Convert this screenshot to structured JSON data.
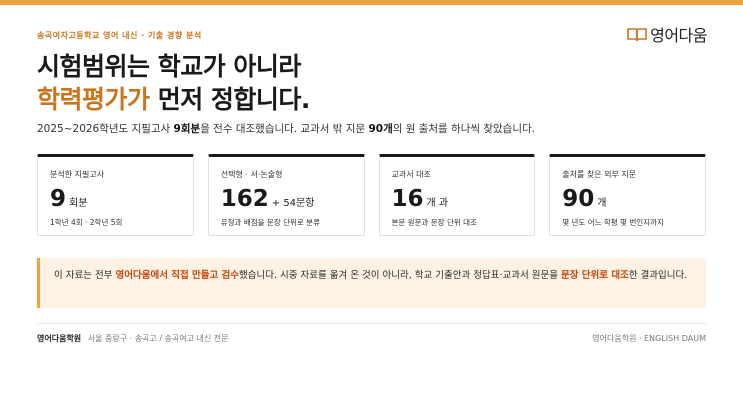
{
  "eyebrow": "송곡여자고등학교 영어 내신 · 기출 경향 분석",
  "logo": {
    "text": "영어다움",
    "icon": "book-icon",
    "color": "#c8761d"
  },
  "headline": {
    "line1": "시험범위는 학교가 아니라",
    "accent": "학력평가가",
    "line2_rest": " 먼저 정합니다."
  },
  "lede": {
    "p1": "2025~2026학년도 지필고사 ",
    "b1": "9회분",
    "p2": "을 전수 대조했습니다. 교과서 밖 지문 ",
    "b2": "90개",
    "p3": "의 원 출처를 하나씩 찾았습니다."
  },
  "cards": [
    {
      "label": "분석한 지필고사",
      "value": "9",
      "unit": "회분",
      "note": "1학년 4회 · 2학년 5회"
    },
    {
      "label": "선택형 · 서·논술형",
      "value": "162",
      "unit": "+ 54문항",
      "note": "유형과 배점을 문장 단위로 분류"
    },
    {
      "label": "교과서 대조",
      "value": "16",
      "unit": "개 과",
      "note": "본문 원문과 문장 단위 대조"
    },
    {
      "label": "출처를 찾은 외부 지문",
      "value": "90",
      "unit": "개",
      "note": "몇 년도 어느 학평 몇 번인지까지"
    }
  ],
  "callout": {
    "t1": "이 자료는 전부 ",
    "h1": "영어다움에서 직접 만들고 검수",
    "t2": "했습니다. 시중 자료를 옮겨 온 것이 아니라, 학교 기출안과 정답표·교과서 원문을 ",
    "h2": "문장 단위로 대조",
    "t3": "한 결과입니다."
  },
  "footer": {
    "brand": "영어다움학원",
    "sub": "서울 중랑구 · 송곡고 / 송곡여고 내신 전문",
    "right": "영어다움학원 · ENGLISH DAUM"
  },
  "colors": {
    "accent": "#f2a23a",
    "accent_dark": "#c8761d",
    "highlight": "#c8480f",
    "callout_bg": "#fdf2e4"
  }
}
